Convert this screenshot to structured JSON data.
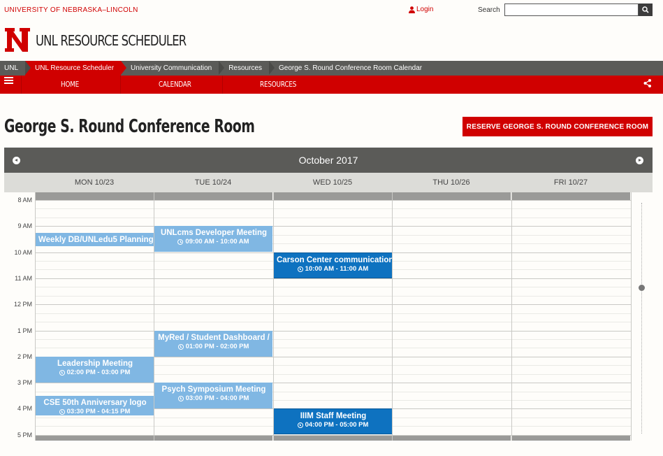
{
  "header": {
    "university": "UNIVERSITY OF NEBRASKA–LINCOLN",
    "login": "Login",
    "search_label": "Search",
    "search_value": "",
    "site_title": "UNL RESOURCE SCHEDULER"
  },
  "breadcrumbs": [
    "UNL",
    "UNL Resource Scheduler",
    "University Communication",
    "Resources",
    "George S. Round Conference Room Calendar"
  ],
  "nav": {
    "items": [
      "HOME",
      "CALENDAR",
      "RESOURCES"
    ]
  },
  "page": {
    "title": "George S. Round Conference Room",
    "reserve_button": "RESERVE GEORGE S. ROUND CONFERENCE ROOM"
  },
  "calendar": {
    "month": "October 2017",
    "days": [
      "MON 10/23",
      "TUE 10/24",
      "WED 10/25",
      "THU 10/26",
      "FRI 10/27"
    ],
    "hours": [
      "8 AM",
      "9 AM",
      "10 AM",
      "11 AM",
      "12 PM",
      "1 PM",
      "2 PM",
      "3 PM",
      "4 PM",
      "5 PM"
    ],
    "events": [
      {
        "day": 0,
        "start": 9.25,
        "end": 9.75,
        "title": "Weekly DB/UNLedu5 Planning",
        "time": "",
        "style": "light"
      },
      {
        "day": 1,
        "start": 9.0,
        "end": 10.0,
        "title": "UNLcms Developer Meeting",
        "time": "09:00 AM - 10:00 AM",
        "style": "light"
      },
      {
        "day": 2,
        "start": 10.0,
        "end": 11.0,
        "title": "Carson Center communication",
        "time": "10:00 AM - 11:00 AM",
        "style": "dark"
      },
      {
        "day": 1,
        "start": 13.0,
        "end": 14.0,
        "title": "MyRed / Student Dashboard /",
        "time": "01:00 PM - 02:00 PM",
        "style": "light"
      },
      {
        "day": 0,
        "start": 14.0,
        "end": 15.0,
        "title": "Leadership Meeting",
        "time": "02:00 PM - 03:00 PM",
        "style": "light"
      },
      {
        "day": 1,
        "start": 15.0,
        "end": 16.0,
        "title": "Psych Symposium Meeting",
        "time": "03:00 PM - 04:00 PM",
        "style": "light"
      },
      {
        "day": 0,
        "start": 15.5,
        "end": 16.25,
        "title": "CSE 50th Anniversary logo",
        "time": "03:30 PM - 04:15 PM",
        "style": "light"
      },
      {
        "day": 2,
        "start": 16.0,
        "end": 17.0,
        "title": "IIIM Staff Meeting",
        "time": "04:00 PM - 05:00 PM",
        "style": "dark"
      }
    ]
  },
  "colors": {
    "brand_red": "#d00000",
    "dark_gray": "#5b5b58",
    "event_light": "#80b7e3",
    "event_dark": "#0e72c0"
  },
  "icons": [
    "user-icon",
    "search-icon",
    "hamburger-icon",
    "share-icon",
    "prev-arrow-icon",
    "next-arrow-icon",
    "clock-icon"
  ]
}
